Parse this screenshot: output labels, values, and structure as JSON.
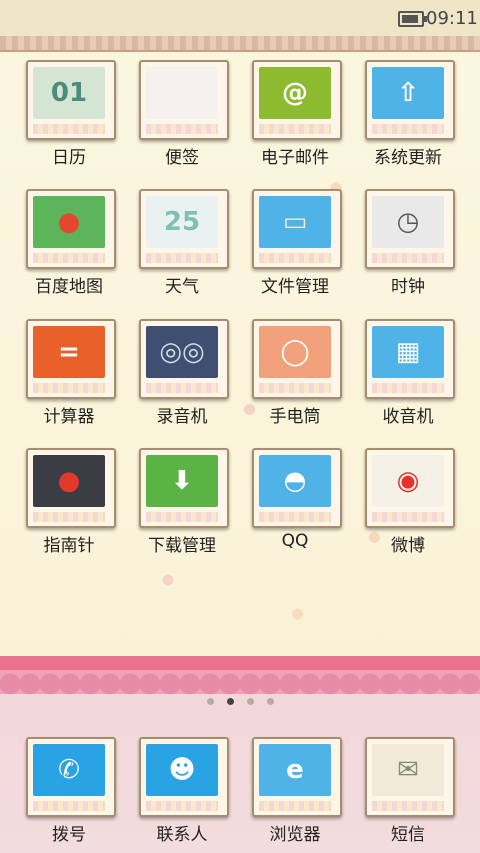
{
  "status_bar": {
    "time": "09:11",
    "battery_icon": "battery-icon"
  },
  "grid": [
    {
      "label": "日历",
      "icon": "calendar-icon",
      "glyph": "01",
      "bg": "#d4e6d3",
      "fg": "#4c8c7a"
    },
    {
      "label": "便签",
      "icon": "notes-icon",
      "glyph": "",
      "bg": "#f4f1ee",
      "fg": "#999"
    },
    {
      "label": "电子邮件",
      "icon": "email-icon",
      "glyph": "@",
      "bg": "#8dbb2f",
      "fg": "#fff"
    },
    {
      "label": "系统更新",
      "icon": "system-update-icon",
      "glyph": "⇧",
      "bg": "#4fb3e8",
      "fg": "#fff"
    },
    {
      "label": "百度地图",
      "icon": "map-icon",
      "glyph": "●",
      "bg": "#5eb45a",
      "fg": "#e3482f"
    },
    {
      "label": "天气",
      "icon": "weather-icon",
      "glyph": "25",
      "bg": "#eaf2f1",
      "fg": "#7fbfb6"
    },
    {
      "label": "文件管理",
      "icon": "file-manager-icon",
      "glyph": "▭",
      "bg": "#4fb3e8",
      "fg": "#f7e9d0"
    },
    {
      "label": "时钟",
      "icon": "clock-icon",
      "glyph": "◷",
      "bg": "#e9e9e9",
      "fg": "#555"
    },
    {
      "label": "计算器",
      "icon": "calculator-icon",
      "glyph": "=",
      "bg": "#e8612b",
      "fg": "#fff"
    },
    {
      "label": "录音机",
      "icon": "recorder-icon",
      "glyph": "◎◎",
      "bg": "#3f4f72",
      "fg": "#d9dde8"
    },
    {
      "label": "手电筒",
      "icon": "flashlight-icon",
      "glyph": "◯",
      "bg": "#f2a27a",
      "fg": "#fff"
    },
    {
      "label": "收音机",
      "icon": "radio-icon",
      "glyph": "▦",
      "bg": "#4fb3e8",
      "fg": "#fff"
    },
    {
      "label": "指南针",
      "icon": "compass-icon",
      "glyph": "●",
      "bg": "#3a3d43",
      "fg": "#e23a2a"
    },
    {
      "label": "下载管理",
      "icon": "download-icon",
      "glyph": "⬇",
      "bg": "#5bb345",
      "fg": "#fff"
    },
    {
      "label": "QQ",
      "icon": "qq-icon",
      "glyph": "◓",
      "bg": "#4fb3e8",
      "fg": "#fff"
    },
    {
      "label": "微博",
      "icon": "weibo-icon",
      "glyph": "◉",
      "bg": "#f5f1e6",
      "fg": "#e8312a"
    }
  ],
  "page_indicator": {
    "pages": 4,
    "active": 1
  },
  "dock": [
    {
      "label": "拨号",
      "icon": "phone-icon",
      "glyph": "✆",
      "bg": "#2aa3e5",
      "fg": "#fff"
    },
    {
      "label": "联系人",
      "icon": "contacts-icon",
      "glyph": "☻",
      "bg": "#2aa3e5",
      "fg": "#fff"
    },
    {
      "label": "浏览器",
      "icon": "browser-icon",
      "glyph": "e",
      "bg": "#4fb3e8",
      "fg": "#fff"
    },
    {
      "label": "短信",
      "icon": "message-icon",
      "glyph": "✉",
      "bg": "#f1ead8",
      "fg": "#7f8f6d"
    }
  ]
}
